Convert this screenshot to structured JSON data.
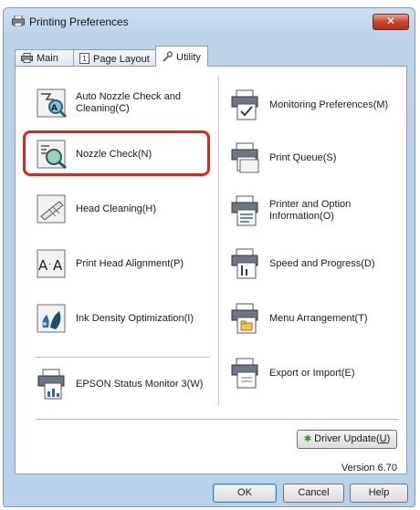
{
  "window": {
    "title": "Printing Preferences"
  },
  "tabs": [
    {
      "label": "Main",
      "icon": "printer-icon"
    },
    {
      "label": "Page Layout",
      "icon": "page-icon"
    },
    {
      "label": "Utility",
      "icon": "wrench-icon",
      "active": true
    }
  ],
  "utility": {
    "left": [
      {
        "label": "Auto Nozzle Check and Cleaning(C)",
        "icon": "auto-nozzle-check-icon"
      },
      {
        "label": "Nozzle Check(N)",
        "icon": "nozzle-check-icon"
      },
      {
        "label": "Head Cleaning(H)",
        "icon": "head-cleaning-icon"
      },
      {
        "label": "Print Head Alignment(P)",
        "icon": "print-head-alignment-icon"
      },
      {
        "label": "Ink Density Optimization(I)",
        "icon": "ink-density-icon"
      },
      {
        "label": "EPSON Status Monitor 3(W)",
        "icon": "status-monitor-icon"
      }
    ],
    "right": [
      {
        "label": "Monitoring Preferences(M)",
        "icon": "monitoring-preferences-icon"
      },
      {
        "label": "Print Queue(S)",
        "icon": "print-queue-icon"
      },
      {
        "label": "Printer and Option Information(O)",
        "icon": "printer-info-icon"
      },
      {
        "label": "Speed and Progress(D)",
        "icon": "speed-progress-icon"
      },
      {
        "label": "Menu Arrangement(T)",
        "icon": "menu-arrangement-icon"
      },
      {
        "label": "Export or Import(E)",
        "icon": "export-import-icon"
      }
    ],
    "highlighted_item": "Nozzle Check(N)",
    "highlight_color": "#e0241b"
  },
  "driver_update": {
    "label_main": "Driver Update(",
    "label_key": "U",
    "label_end": ")"
  },
  "version": "Version 6.70",
  "buttons": {
    "ok": "OK",
    "cancel": "Cancel",
    "help": "Help"
  },
  "close": "✕"
}
